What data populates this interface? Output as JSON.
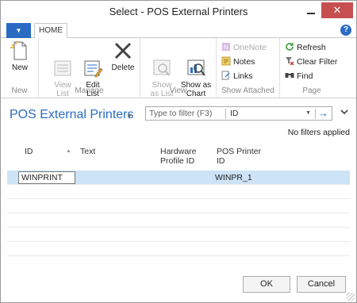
{
  "window": {
    "title": "Select - POS External Printers",
    "close_glyph": "✕",
    "min_glyph": ""
  },
  "ribbon": {
    "app_button": "▼",
    "tab": "HOME",
    "help": "?",
    "groups": [
      {
        "label": "New",
        "buttons": [
          {
            "label": "New",
            "icon": "new-document-icon",
            "enabled": true
          }
        ]
      },
      {
        "label": "Manage",
        "buttons": [
          {
            "label": "View\nList",
            "icon": "view-list-icon",
            "enabled": false
          },
          {
            "label": "Edit\nList",
            "icon": "edit-list-icon",
            "enabled": true
          },
          {
            "label": "Delete",
            "icon": "delete-icon",
            "enabled": true
          }
        ]
      },
      {
        "label": "View",
        "buttons": [
          {
            "label": "Show\nas List",
            "icon": "show-as-list-icon",
            "enabled": false
          },
          {
            "label": "Show as\nChart",
            "icon": "show-as-chart-icon",
            "enabled": true
          }
        ]
      },
      {
        "label": "Show Attached",
        "buttons": [
          {
            "label": "OneNote",
            "icon": "onenote-icon",
            "enabled": false
          },
          {
            "label": "Notes",
            "icon": "notes-icon",
            "enabled": true
          },
          {
            "label": "Links",
            "icon": "links-icon",
            "enabled": true
          }
        ]
      },
      {
        "label": "Page",
        "buttons": [
          {
            "label": "Refresh",
            "icon": "refresh-icon",
            "enabled": true
          },
          {
            "label": "Clear Filter",
            "icon": "clear-filter-icon",
            "enabled": true
          },
          {
            "label": "Find",
            "icon": "find-icon",
            "enabled": true
          }
        ]
      }
    ]
  },
  "page": {
    "title": "POS External Printers",
    "filter_placeholder": "Type to filter (F3)",
    "filter_field": "ID",
    "no_filters": "No filters applied"
  },
  "grid": {
    "columns": [
      "ID",
      "Text",
      "Hardware\nProfile ID",
      "POS Printer\nID"
    ],
    "rows": [
      {
        "id": "WINPRINT",
        "text": "",
        "hardware_profile_id": "",
        "pos_printer_id": "WINPR_1"
      }
    ]
  },
  "footer": {
    "ok": "OK",
    "cancel": "Cancel"
  },
  "colors": {
    "accent": "#2a6cc4",
    "close": "#c74f4f",
    "selected_row": "#cde3f6"
  }
}
